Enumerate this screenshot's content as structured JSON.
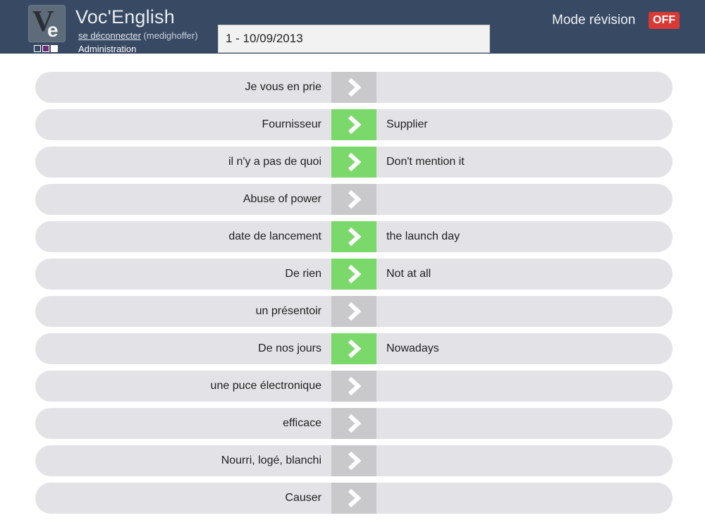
{
  "header": {
    "logo": {
      "letter1": "V",
      "letter2": "e"
    },
    "app_title": "Voc'English",
    "logout_label": "se déconnecter",
    "username": "(medighoffer)",
    "admin_label": "Administration",
    "list_selected": "1 - 10/09/2013",
    "mode_label": "Mode révision",
    "mode_state": "OFF",
    "swatch_colors": [
      "#384a63",
      "#6d2b78",
      "#ffffff"
    ]
  },
  "colors": {
    "header_bg": "#384a63",
    "row_bg": "#e3e2e7",
    "arrow_inactive": "#c9c9cb",
    "arrow_active": "#7bd86a",
    "off_badge": "#d93a35"
  },
  "rows": [
    {
      "fr": "Je vous en prie",
      "en": "",
      "revealed": false
    },
    {
      "fr": "Fournisseur",
      "en": "Supplier",
      "revealed": true
    },
    {
      "fr": "il n'y a pas de quoi",
      "en": "Don't mention it",
      "revealed": true
    },
    {
      "fr": "Abuse of power",
      "en": "",
      "revealed": false
    },
    {
      "fr": "date de lancement",
      "en": "the launch day",
      "revealed": true
    },
    {
      "fr": "De rien",
      "en": "Not at all",
      "revealed": true
    },
    {
      "fr": "un présentoir",
      "en": "",
      "revealed": false
    },
    {
      "fr": "De nos jours",
      "en": "Nowadays",
      "revealed": true
    },
    {
      "fr": "une puce électronique",
      "en": "",
      "revealed": false
    },
    {
      "fr": "efficace",
      "en": "",
      "revealed": false
    },
    {
      "fr": "Nourri, logé, blanchi",
      "en": "",
      "revealed": false
    },
    {
      "fr": "Causer",
      "en": "",
      "revealed": false
    }
  ]
}
